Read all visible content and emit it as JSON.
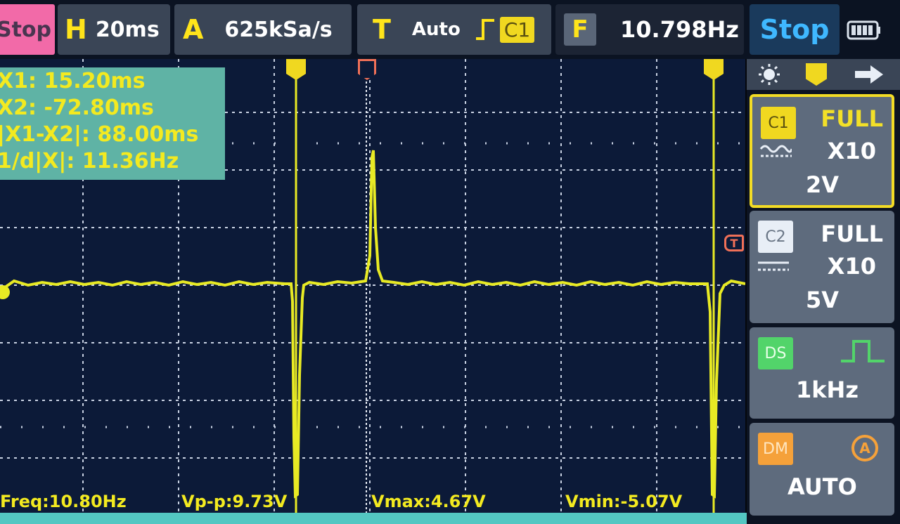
{
  "top_bar": {
    "run_state_button": "Stop",
    "horizontal": {
      "label": "H",
      "value": "20ms"
    },
    "acquisition": {
      "label": "A",
      "value": "625kSa/s"
    },
    "trigger": {
      "label": "T",
      "mode": "Auto",
      "channel": "C1"
    },
    "frequency": {
      "label": "F",
      "value": "10.798Hz"
    },
    "status": "Stop"
  },
  "cursor_panel": {
    "lines": [
      "X1: 15.20ms",
      "X2: -72.80ms",
      "|X1-X2|: 88.00ms",
      "1/d|X|: 11.36Hz"
    ]
  },
  "markers": {
    "x1": "X1",
    "x2": "X2",
    "trigger_pos": "T",
    "trigger_level": "T"
  },
  "measurements": {
    "freq": "Freq:10.80Hz",
    "vpp": "Vp-p:9.73V",
    "vmax": "Vmax:4.67V",
    "vmin": "Vmin:-5.07V"
  },
  "side_panel": {
    "icons": [
      "brightness-icon",
      "cursor-x2-icon",
      "next-page-icon"
    ],
    "channels": [
      {
        "tag": "C1",
        "bandwidth": "FULL",
        "probe": "X10",
        "scale": "2V",
        "coupling": "AC"
      },
      {
        "tag": "C2",
        "bandwidth": "FULL",
        "probe": "X10",
        "scale": "5V",
        "coupling": "DC"
      }
    ],
    "ds": {
      "tag": "DS",
      "frequency": "1kHz"
    },
    "dm": {
      "tag": "DM",
      "mode": "AUTO"
    }
  },
  "colors": {
    "trace": "#e8ea24",
    "grid": "#c9d2e3",
    "screen_bg": "#0c1a38",
    "accent_pink": "#f26aa8",
    "cursor_box": "#5fb3a5"
  }
}
